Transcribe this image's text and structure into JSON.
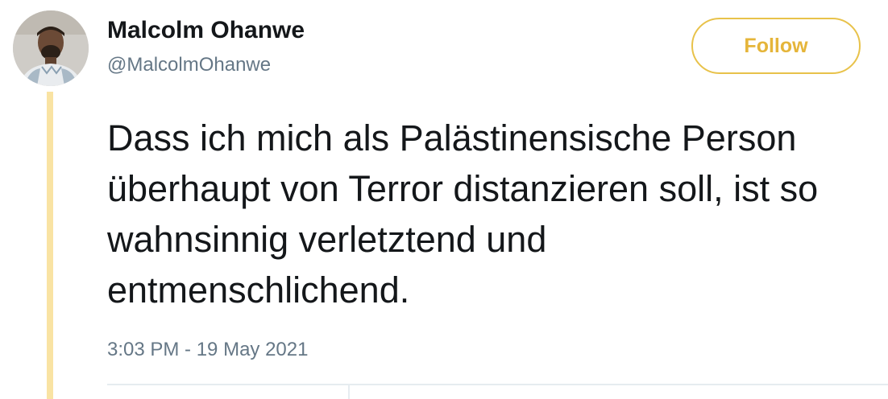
{
  "tweet": {
    "author": {
      "display_name": "Malcolm Ohanwe",
      "handle": "@MalcolmOhanwe"
    },
    "follow_label": "Follow",
    "text": "Dass ich mich als Palästinensische Person überhaupt von Terror distanzieren soll, ist so wahnsinnig verletztend und entmenschlichend.",
    "timestamp": "3:03 PM - 19 May 2021"
  },
  "colors": {
    "accent": "#e5b53a",
    "thread_line": "#f9e3a3",
    "text_primary": "#14171a",
    "text_secondary": "#657786",
    "divider": "#e6ecf0"
  },
  "icons": {
    "avatar": "user-avatar-photo"
  }
}
